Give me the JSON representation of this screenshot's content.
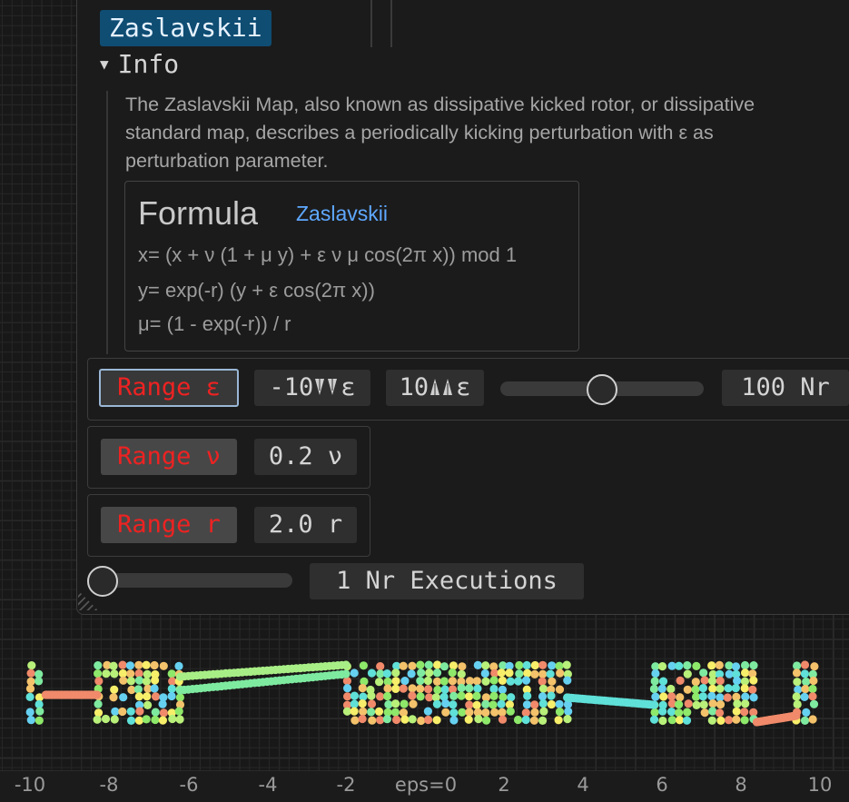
{
  "panel": {
    "title": "Zaslavskii",
    "info_header": "Info",
    "info_arrow": "▼",
    "description": "The Zaslavskii Map, also known as dissipative kicked rotor, or dissipative standard map, describes a periodically kicking perturbation with ε as perturbation parameter.",
    "formula": {
      "title": "Formula",
      "link": "Zaslavskii",
      "lines": [
        "x= (x + ν (1 + μ y) + ε ν μ cos(2π x)) mod 1",
        "y= exp(-r) (y + ε cos(2π x))",
        "μ= (1 - exp(-r)) / r"
      ]
    },
    "range_eps": {
      "button": "Range ε",
      "min": "-10",
      "min_suffix": "ε",
      "min_icon": "down-arrows-icon",
      "max": "10",
      "max_suffix": "ε",
      "max_icon": "up-arrows-icon",
      "nr": "100 Nr",
      "slider_fraction": 0.5
    },
    "range_nu": {
      "button": "Range ν",
      "value": "0.2 ν"
    },
    "range_r": {
      "button": "Range r",
      "value": "2.0 r"
    },
    "executions": {
      "label": "1 Nr Executions",
      "slider_fraction": 0.0
    }
  },
  "axis": {
    "x_ticks": [
      "-10",
      "-8",
      "-6",
      "-4",
      "-2",
      "eps=0",
      "2",
      "4",
      "6",
      "8",
      "10"
    ]
  },
  "chart_data": {
    "type": "scatter",
    "xlim": [
      -10,
      10
    ],
    "description_x": "eps",
    "bands": [
      {
        "x_from": -10.0,
        "x_to": -9.6
      },
      {
        "x_from": -8.3,
        "x_to": -6.2
      },
      {
        "x_from": -2.0,
        "x_to": 3.6
      },
      {
        "x_from": 5.8,
        "x_to": 8.4
      },
      {
        "x_from": 9.4,
        "x_to": 10.0
      }
    ]
  },
  "colors": {
    "accent": "#0f4d73",
    "range_text": "#ee2222",
    "link": "#5fa8ff"
  }
}
